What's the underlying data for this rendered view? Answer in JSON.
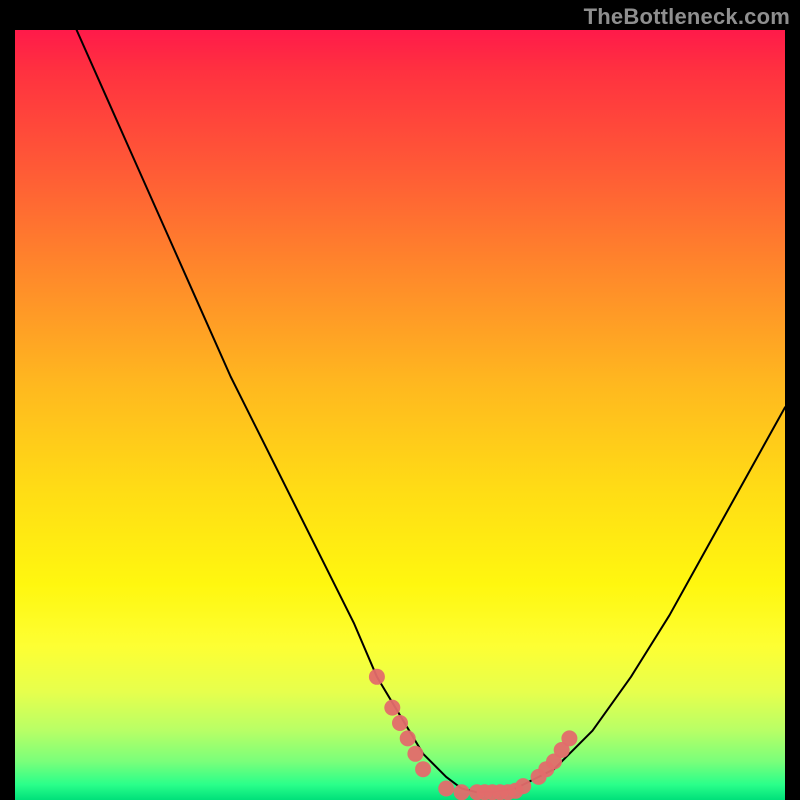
{
  "watermark": "TheBottleneck.com",
  "chart_data": {
    "type": "line",
    "title": "",
    "xlabel": "",
    "ylabel": "",
    "xlim": [
      0,
      100
    ],
    "ylim": [
      0,
      100
    ],
    "series": [
      {
        "name": "curve",
        "x": [
          8,
          12,
          16,
          20,
          24,
          28,
          32,
          36,
          40,
          44,
          47,
          50,
          53,
          56,
          58,
          60,
          62,
          65,
          70,
          75,
          80,
          85,
          90,
          95,
          100
        ],
        "y": [
          100,
          91,
          82,
          73,
          64,
          55,
          47,
          39,
          31,
          23,
          16,
          11,
          6,
          3,
          1.5,
          1,
          1,
          1.5,
          4,
          9,
          16,
          24,
          33,
          42,
          51
        ]
      }
    ],
    "markers_low": [
      {
        "name": "left-cluster",
        "x": [
          47,
          49,
          50,
          51,
          52,
          53
        ],
        "y": [
          16,
          12,
          10,
          8,
          6,
          4
        ]
      },
      {
        "name": "bottom-cluster",
        "x": [
          56,
          58,
          60,
          61,
          62,
          63,
          64,
          65,
          66
        ],
        "y": [
          1.5,
          1,
          1,
          1,
          1,
          1,
          1,
          1.2,
          1.8
        ]
      },
      {
        "name": "right-cluster",
        "x": [
          68,
          69,
          70,
          71,
          72
        ],
        "y": [
          3,
          4,
          5,
          6.5,
          8
        ]
      }
    ],
    "marker_color": "#e36b6b",
    "curve_color": "#000000"
  }
}
